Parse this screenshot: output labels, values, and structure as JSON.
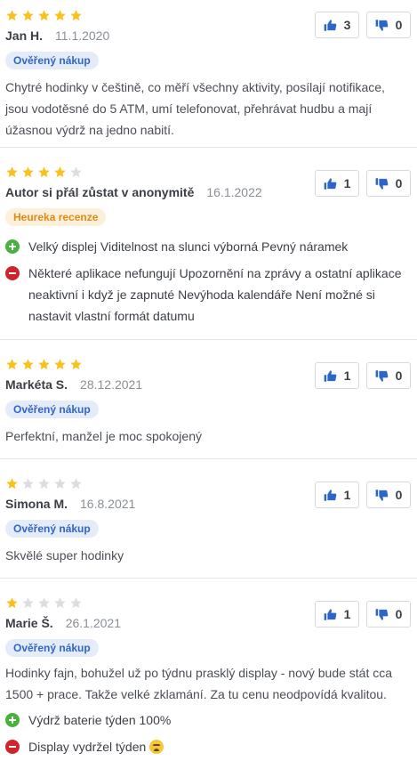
{
  "colors": {
    "star_on": "#f8c11c",
    "star_off": "#dcdde0",
    "pro": "#47b33c",
    "con": "#d2232a",
    "accent": "#2c66c8"
  },
  "icons": {
    "star": "star-icon",
    "like": "thumbs-up-icon",
    "dislike": "thumbs-down-icon",
    "pro": "plus-circle-icon",
    "con": "minus-circle-icon"
  },
  "reviews": [
    {
      "rating": 5,
      "author": "Jan H.",
      "date": "11.1.2020",
      "badge": "Ověřený nákup",
      "text": "Chytré hodinky v češtině, co měří všechny aktivity, posílají notifikace, jsou vodotěsné do 5 ATM, umí telefonovat, přehrávat hudbu a mají úžasnou výdrž na jedno nabití.",
      "likes": "3",
      "dislikes": "0"
    },
    {
      "rating": 4,
      "author": "Autor si přál zůstat v anonymitě",
      "date": "16.1.2022",
      "badge": "Heureka recenze",
      "pro": "Velký displej Viditelnost na slunci výborná Pevný náramek",
      "con": "Některé aplikace nefungují Upozornění na zprávy a ostatní aplikace neaktivní i když je zapnuté Nevýhoda kalendáře Není možné si nastavit vlastní formát datumu",
      "likes": "1",
      "dislikes": "0"
    },
    {
      "rating": 5,
      "author": "Markéta S.",
      "date": "28.12.2021",
      "badge": "Ověřený nákup",
      "text": "Perfektní, manžel je moc spokojený",
      "likes": "1",
      "dislikes": "0"
    },
    {
      "rating": 1,
      "author": "Simona M.",
      "date": "16.8.2021",
      "badge": "Ověřený nákup",
      "text": "Skvělé super hodinky",
      "likes": "1",
      "dislikes": "0"
    },
    {
      "rating": 1,
      "author": "Marie Š.",
      "date": "26.1.2021",
      "badge": "Ověřený nákup",
      "text": "Hodinky fajn, bohužel už po týdnu prasklý display - nový bude stát cca 1500 + prace. Takže velké zklamání. Za tu cenu neodpovídá kvalitou.",
      "pro": "Výdrž baterie týden 100%",
      "con": "Display vydržel týden",
      "likes": "1",
      "dislikes": "0"
    }
  ]
}
